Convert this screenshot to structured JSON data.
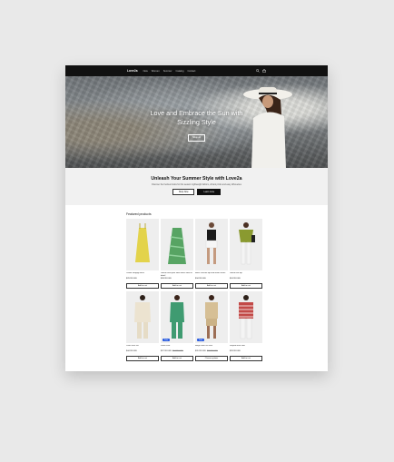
{
  "nav": {
    "logo": "Love2a",
    "links": [
      "New",
      "Women",
      "Summer",
      "Catalog",
      "Contact"
    ]
  },
  "hero": {
    "title": "Love and Embrace the Sun with Sizzling Style",
    "button": "Shop all"
  },
  "promo": {
    "title": "Unleash Your Summer Style with Love2a",
    "text": "Discover the freshest looks for this season: lightweight fabrics, vibrant prints and easy silhouettes",
    "primary_button": "Shop Now",
    "secondary_button": "Learn more"
  },
  "featured": {
    "title": "Featured products",
    "products": [
      {
        "name": "Yellow strappy dress",
        "price": "$29.99 USD",
        "old_price": "",
        "sale": false,
        "button": "Add to cart",
        "garment": "#e3d34b"
      },
      {
        "name": "Green floral print linen dress with tie detail",
        "price": "$39.99 USD",
        "old_price": "",
        "sale": false,
        "button": "Add to cart",
        "garment": "#57a463"
      },
      {
        "name": "Black crochet top and white shorts",
        "price": "$34.99 USD",
        "old_price": "",
        "sale": false,
        "button": "Add to cart",
        "garment": "#1a1a1a"
      },
      {
        "name": "Green knit top",
        "price": "$24.99 USD",
        "old_price": "",
        "sale": false,
        "button": "Add to cart",
        "garment": "#8a9a30"
      },
      {
        "name": "Linen shirt set",
        "price": "$44.99 USD",
        "old_price": "",
        "sale": false,
        "button": "Add to cart",
        "garment": "#ece3d0"
      },
      {
        "name": "Floral shirt",
        "price": "$27.99 USD",
        "old_price": "$34.99 USD",
        "sale": true,
        "sale_label": "Sale",
        "button": "Add to cart",
        "garment": "#3f9b71"
      },
      {
        "name": "Beige linen set shirt",
        "price": "$31.99 USD",
        "old_price": "$39.99 USD",
        "sale": true,
        "sale_label": "Sale",
        "button": "Choose options",
        "garment": "#d6bf95"
      },
      {
        "name": "Striped linen shirt",
        "price": "$29.99 USD",
        "old_price": "",
        "sale": false,
        "button": "Add to cart",
        "garment": "#c24a48"
      }
    ]
  }
}
